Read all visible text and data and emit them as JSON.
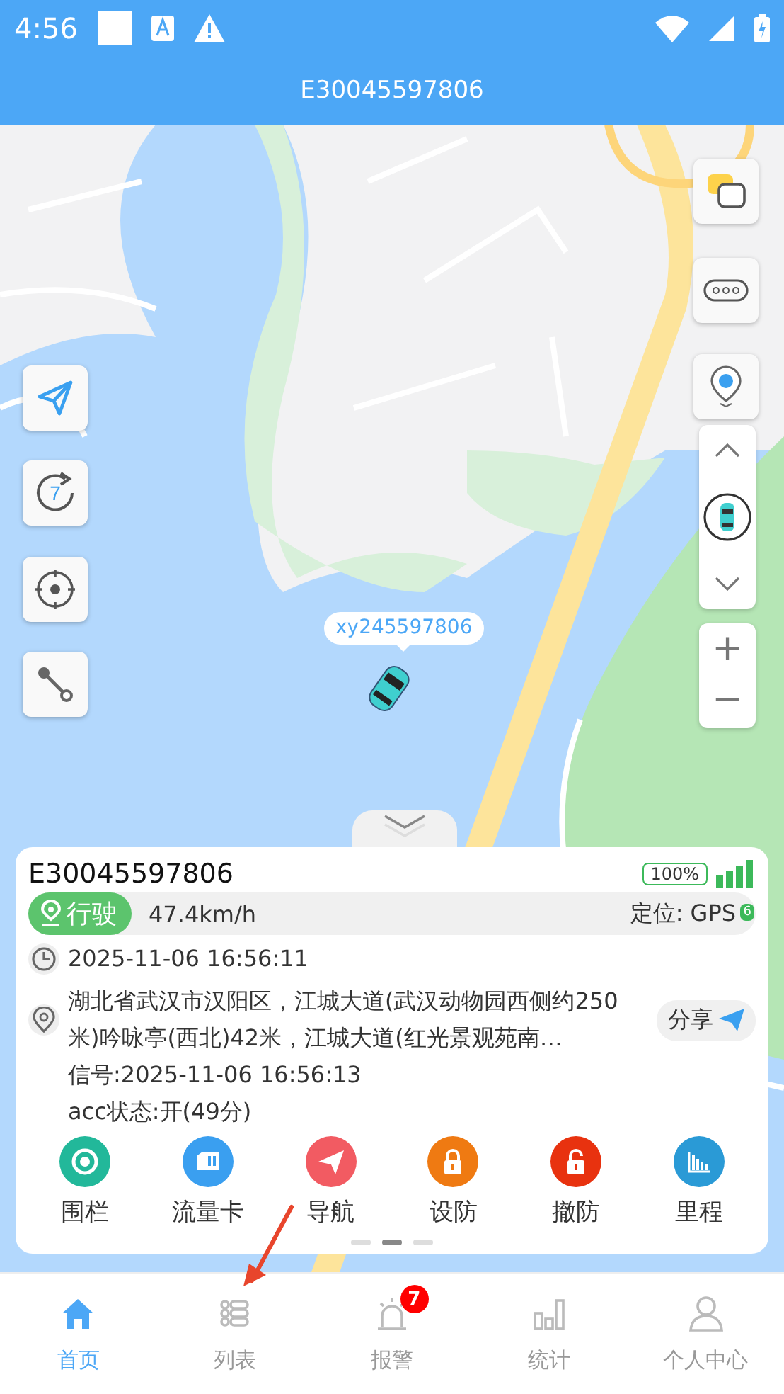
{
  "status_bar": {
    "time": "4:56"
  },
  "title": "E30045597806",
  "map": {
    "kind": "picture",
    "rotate_badge": "7",
    "marker_label": "xy245597806",
    "zoom_in": "+",
    "zoom_out": "−"
  },
  "card": {
    "device": "E30045597806",
    "battery": "100%",
    "status": "行驶",
    "speed": "47.4km/h",
    "positioning": "定位: GPS",
    "satellites": "6",
    "time": "2025-11-06 16:56:11",
    "address": "湖北省武汉市汉阳区，江城大道(武汉动物园西侧约250米)吟咏亭(西北)42米，江城大道(红光景观苑南…",
    "share": "分享",
    "lines": [
      "信号:2025-11-06 16:56:13",
      "acc状态:开(49分)"
    ],
    "actions": [
      {
        "label": "围栏",
        "kind": "fence",
        "color": "#22b89a"
      },
      {
        "label": "流量卡",
        "kind": "card",
        "color": "#3a9ff0"
      },
      {
        "label": "导航",
        "kind": "nav",
        "color": "#f25b62"
      },
      {
        "label": "设防",
        "kind": "lock",
        "color": "#ef7a12"
      },
      {
        "label": "撤防",
        "kind": "unlock",
        "color": "#e8320f"
      },
      {
        "label": "里程",
        "kind": "bars",
        "color": "#2a9ad6"
      }
    ],
    "pages": [
      {
        "selected": false
      },
      {
        "selected": true
      },
      {
        "selected": false
      }
    ]
  },
  "tabs": [
    {
      "label": "首页",
      "kind": "home",
      "selected": true
    },
    {
      "label": "列表",
      "kind": "list",
      "selected": false
    },
    {
      "label": "报警",
      "kind": "alarm",
      "selected": false,
      "badge": "7"
    },
    {
      "label": "统计",
      "kind": "stats",
      "selected": false
    },
    {
      "label": "个人中心",
      "kind": "person",
      "selected": false
    }
  ]
}
